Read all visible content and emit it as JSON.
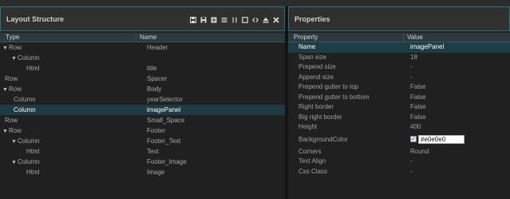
{
  "layout_panel": {
    "title": "Layout Structure",
    "columns": {
      "type": "Type",
      "name": "Name"
    },
    "rows": [
      {
        "type": "Row",
        "name": "Header",
        "indent": 0,
        "expander": true,
        "selected": false
      },
      {
        "type": "Column",
        "name": "",
        "indent": 1,
        "expander": true,
        "selected": false
      },
      {
        "type": "Html",
        "name": "title",
        "indent": 2,
        "expander": false,
        "selected": false
      },
      {
        "type": "Row",
        "name": "Spacer",
        "indent": 0,
        "expander": false,
        "selected": false
      },
      {
        "type": "Row",
        "name": "Body",
        "indent": 0,
        "expander": true,
        "selected": false
      },
      {
        "type": "Column",
        "name": "yearSelector",
        "indent": 1,
        "expander": false,
        "selected": false
      },
      {
        "type": "Column",
        "name": "imagePanel",
        "indent": 1,
        "expander": false,
        "selected": true
      },
      {
        "type": "Row",
        "name": "Small_Space",
        "indent": 0,
        "expander": false,
        "selected": false
      },
      {
        "type": "Row",
        "name": "Footer",
        "indent": 0,
        "expander": true,
        "selected": false
      },
      {
        "type": "Column",
        "name": "Footer_Text",
        "indent": 1,
        "expander": true,
        "selected": false
      },
      {
        "type": "Html",
        "name": "Text",
        "indent": 2,
        "expander": false,
        "selected": false
      },
      {
        "type": "Column",
        "name": "Footer_Image",
        "indent": 1,
        "expander": true,
        "selected": false
      },
      {
        "type": "Html",
        "name": "Image",
        "indent": 2,
        "expander": false,
        "selected": false
      }
    ]
  },
  "properties_panel": {
    "title": "Properties",
    "columns": {
      "property": "Property",
      "value": "Value"
    },
    "rows": [
      {
        "key": "Name",
        "value": "imagePanel",
        "highlight": true
      },
      {
        "key": "Span size",
        "value": "18"
      },
      {
        "key": "Prepend size",
        "value": "-"
      },
      {
        "key": "Append size",
        "value": "-"
      },
      {
        "key": "Prepend gutter to top",
        "value": "False"
      },
      {
        "key": "Prepend gutter to bottom",
        "value": "False"
      },
      {
        "key": "Right border",
        "value": "False"
      },
      {
        "key": "Big right border",
        "value": "False"
      },
      {
        "key": "Height",
        "value": "400"
      },
      {
        "key": "BackgroundColor",
        "value": "#e0e0e0",
        "type": "color",
        "checked": true
      },
      {
        "key": "Corners",
        "value": "Round"
      },
      {
        "key": "Text Align",
        "value": "-"
      },
      {
        "key": "Css Class",
        "value": "-"
      }
    ]
  },
  "icons": [
    "save-icon",
    "save-as-icon",
    "add-icon",
    "list-icon",
    "columns-icon",
    "square-icon",
    "code-icon",
    "eject-icon",
    "close-icon"
  ]
}
